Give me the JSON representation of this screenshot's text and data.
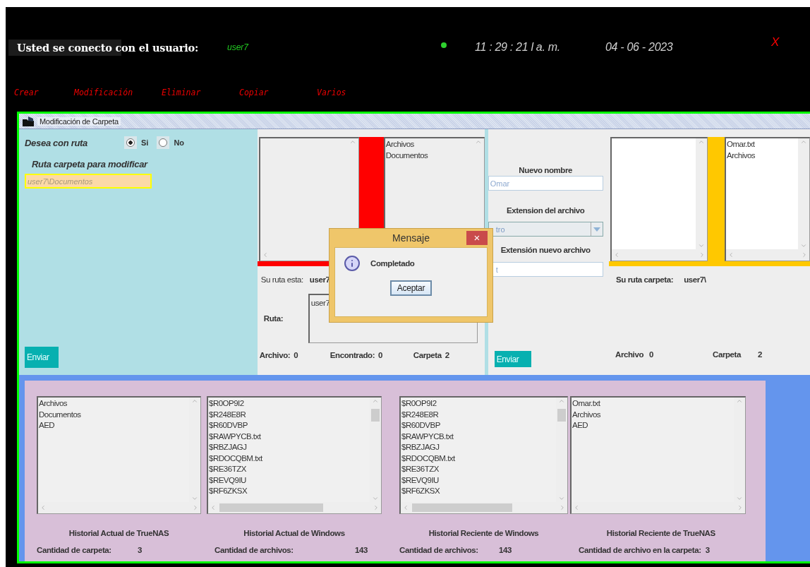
{
  "header": {
    "label": "Usted se conecto con el usuario:",
    "user": "user7",
    "online": true,
    "time": "11 : 29 : 21 l a. m.",
    "date": "04 - 06 - 2023",
    "close": "X"
  },
  "menu": [
    {
      "label": "Crear"
    },
    {
      "label": "Modificación"
    },
    {
      "label": "Eliminar"
    },
    {
      "label": "Copiar"
    },
    {
      "label": "Varios"
    }
  ],
  "window": {
    "title": "Modificación  de Carpeta",
    "route_panel": {
      "question": "Desea con ruta",
      "options": [
        {
          "label": "Si",
          "selected": true
        },
        {
          "label": "No",
          "selected": false
        }
      ],
      "route_label": "Ruta carpeta para modificar",
      "route_placeholder": "user7\\Documentos",
      "submit": "Enviar"
    },
    "source_panel": {
      "right_items": [
        "Archivos",
        "Documentos"
      ],
      "path_label": "Su ruta esta:",
      "path_value": "user7",
      "ruta_label": "Ruta:",
      "ruta_value": "user7",
      "stats": [
        {
          "label": "Archivo:",
          "value": "0"
        },
        {
          "label": "Encontrado:",
          "value": "0"
        },
        {
          "label": "Carpeta",
          "value": "2"
        }
      ]
    },
    "rename_panel": {
      "name_label": "Nuevo nombre",
      "name_placeholder": "Omar",
      "ext_label": "Extension del archivo",
      "ext_value": "tro",
      "new_ext_label": "Extensión nuevo archivo",
      "new_ext_placeholder": "t",
      "submit": "Enviar"
    },
    "target_panel": {
      "right_items": [
        "Omar.txt",
        "Archivos"
      ],
      "path_label": "Su ruta carpeta:",
      "path_value": "user7\\",
      "stats": [
        {
          "label": "Archivo",
          "value": "0"
        },
        {
          "label": "Carpeta",
          "value": "2"
        }
      ]
    }
  },
  "dialog": {
    "title": "Mensaje",
    "close": "×",
    "message": "Completado",
    "button": "Aceptar"
  },
  "history": [
    {
      "title": "Historial Actual de TrueNAS",
      "items": [
        "Archivos",
        "Documentos",
        "AED"
      ],
      "count_label": "Cantidad de carpeta:",
      "count_value": "3"
    },
    {
      "title": "Historial Actual de Windows",
      "items": [
        "$R0OP9I2",
        "$R248E8R",
        "$R60DVBP",
        "$RAWPYCB.txt",
        "$RBZJAGJ",
        "$RDOCQBM.txt",
        "$RE36TZX",
        "$REVQ9IU",
        "$RF6ZKSX"
      ],
      "count_label": "Cantidad de archivos:",
      "count_value": "143"
    },
    {
      "title": "Historial Reciente de Windows",
      "items": [
        "$R0OP9I2",
        "$R248E8R",
        "$R60DVBP",
        "$RAWPYCB.txt",
        "$RBZJAGJ",
        "$RDOCQBM.txt",
        "$RE36TZX",
        "$REVQ9IU",
        "$RF6ZKSX"
      ],
      "count_label": "Cantidad de archivos:",
      "count_value": "143"
    },
    {
      "title": "Historial Reciente de TrueNAS",
      "items": [
        "Omar.txt",
        "Archivos",
        "AED"
      ],
      "count_label": "Cantidad de archivo en la carpeta:",
      "count_value": "3"
    }
  ]
}
